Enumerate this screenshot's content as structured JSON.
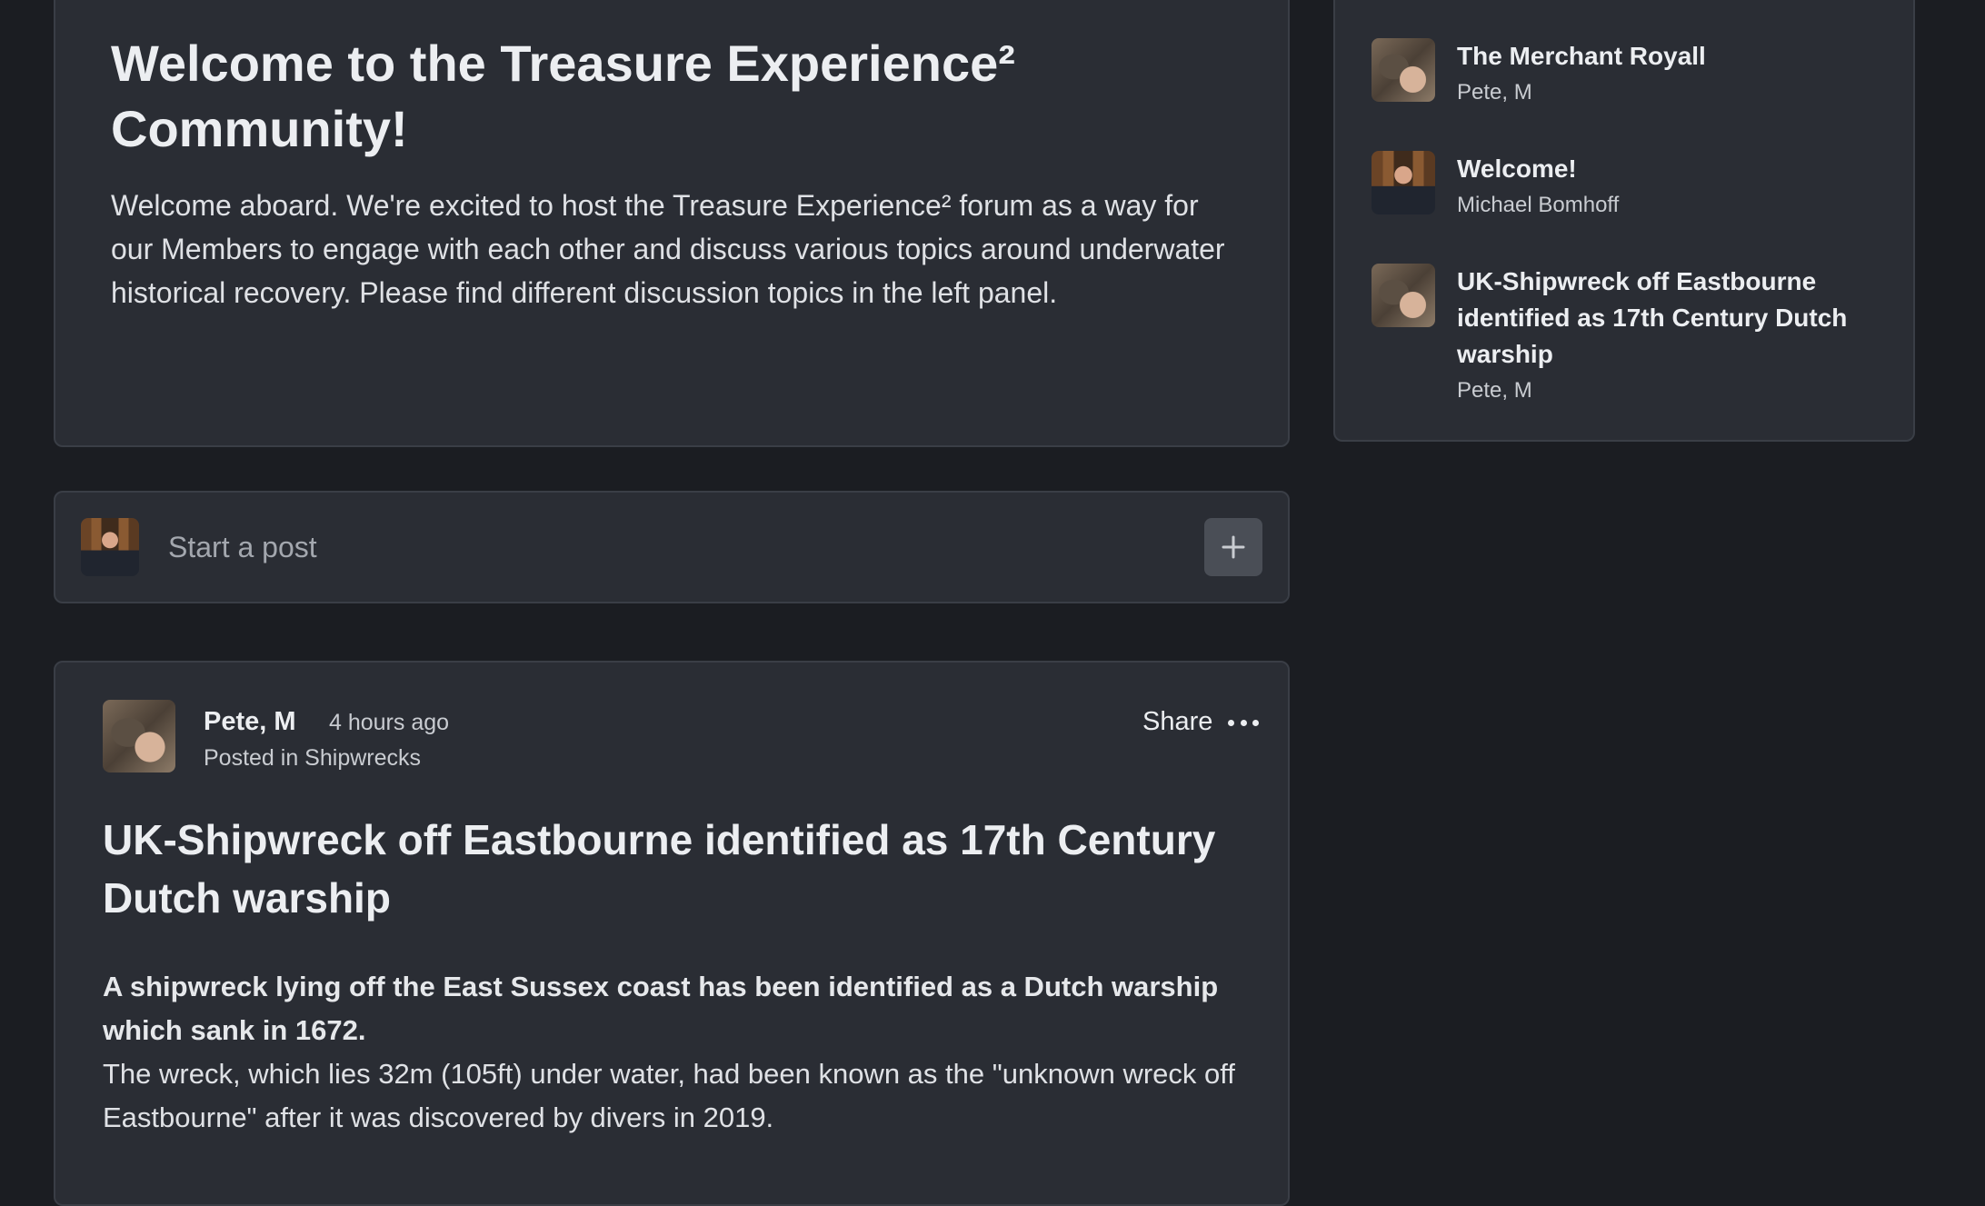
{
  "welcome": {
    "title": "Welcome to the Treasure Experience² Community!",
    "body": "Welcome aboard. We're excited to host the Treasure Experience² forum as a way for our Members to engage with each other and discuss various topics around underwater historical recovery. Please find different discussion topics in the left panel."
  },
  "composer": {
    "placeholder": "Start a post",
    "add_icon": "plus-icon"
  },
  "post": {
    "author": "Pete, M",
    "time": "4 hours ago",
    "location": "Posted in Shipwrecks",
    "share_label": "Share",
    "more_icon": "more-horizontal-icon",
    "title": "UK-Shipwreck off Eastbourne identified as 17th Century Dutch warship",
    "lead": "A shipwreck lying off the East Sussex coast has been identified as a Dutch warship which sank in 1672.",
    "body": "The wreck, which lies 32m (105ft) under water, had been known as the \"unknown wreck off Eastbourne\" after it was discovered by divers in 2019."
  },
  "sidebar": {
    "items": [
      {
        "title": "The Merchant Royall",
        "author": "Pete, M"
      },
      {
        "title": "Welcome!",
        "author": "Michael Bomhoff"
      },
      {
        "title": "UK-Shipwreck off Eastbourne identified as 17th Century Dutch warship",
        "author": "Pete, M"
      }
    ]
  },
  "colors": {
    "background": "#1b1d22",
    "card": "#2a2d34",
    "border": "#3a3e46",
    "text": "#eceef1",
    "muted": "#a3a7ae"
  }
}
